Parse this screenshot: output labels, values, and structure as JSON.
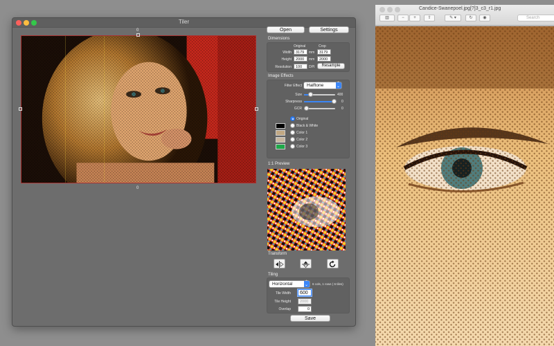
{
  "tiler": {
    "title": "Tiler",
    "guides": {
      "top": "0",
      "bottom": "0"
    },
    "buttons": {
      "open": "Open",
      "settings": "Settings",
      "resample": "Resample",
      "save": "Save"
    },
    "dimensions": {
      "label": "Dimensions",
      "col_original": "Original",
      "col_crop": "Crop",
      "width_label": "Width",
      "height_label": "Height",
      "resolution_label": "Resolution",
      "width_original": "3179",
      "width_crop": "3179",
      "height_original": "2000",
      "height_crop": "2000",
      "resolution": "100",
      "unit_mm": "mm",
      "unit_dpi": "DPI"
    },
    "effects": {
      "label": "Image Effects",
      "filter_label": "Filter Effect",
      "filter_value": "Halftone",
      "size_label": "Size",
      "size_value": "400",
      "sharpness_label": "Sharpness",
      "sharpness_value": "0",
      "gcr_label": "GCR",
      "gcr_value": "0",
      "colors": [
        {
          "label": "Original",
          "selected": true,
          "swatch": "#000000"
        },
        {
          "label": "Black & White",
          "selected": false,
          "swatch": "#000000"
        },
        {
          "label": "Color 1",
          "selected": false,
          "swatch": "#c2a883"
        },
        {
          "label": "Color 2",
          "selected": false,
          "swatch": "#c8b7a0"
        },
        {
          "label": "Color 3",
          "selected": false,
          "swatch": "#1fa849"
        }
      ]
    },
    "preview_label": "1:1 Preview",
    "transform_label": "Transform",
    "tiling": {
      "label": "Tiling",
      "mode": "Horizontal",
      "summary": "6 cols, 1 rows ( 6 tiles)",
      "tile_width_label": "Tile Width",
      "tile_width": "600",
      "tile_height_label": "Tile Height",
      "tile_height": "2000",
      "overlap_label": "Overlap",
      "overlap": "0"
    }
  },
  "preview_window": {
    "filename": "Candice-Swanepoel.jpg[?]3_c3_r1.jpg",
    "search_placeholder": "Search"
  },
  "colors": {
    "accent": "#3b86f7",
    "crop_border": "#aa3333"
  }
}
